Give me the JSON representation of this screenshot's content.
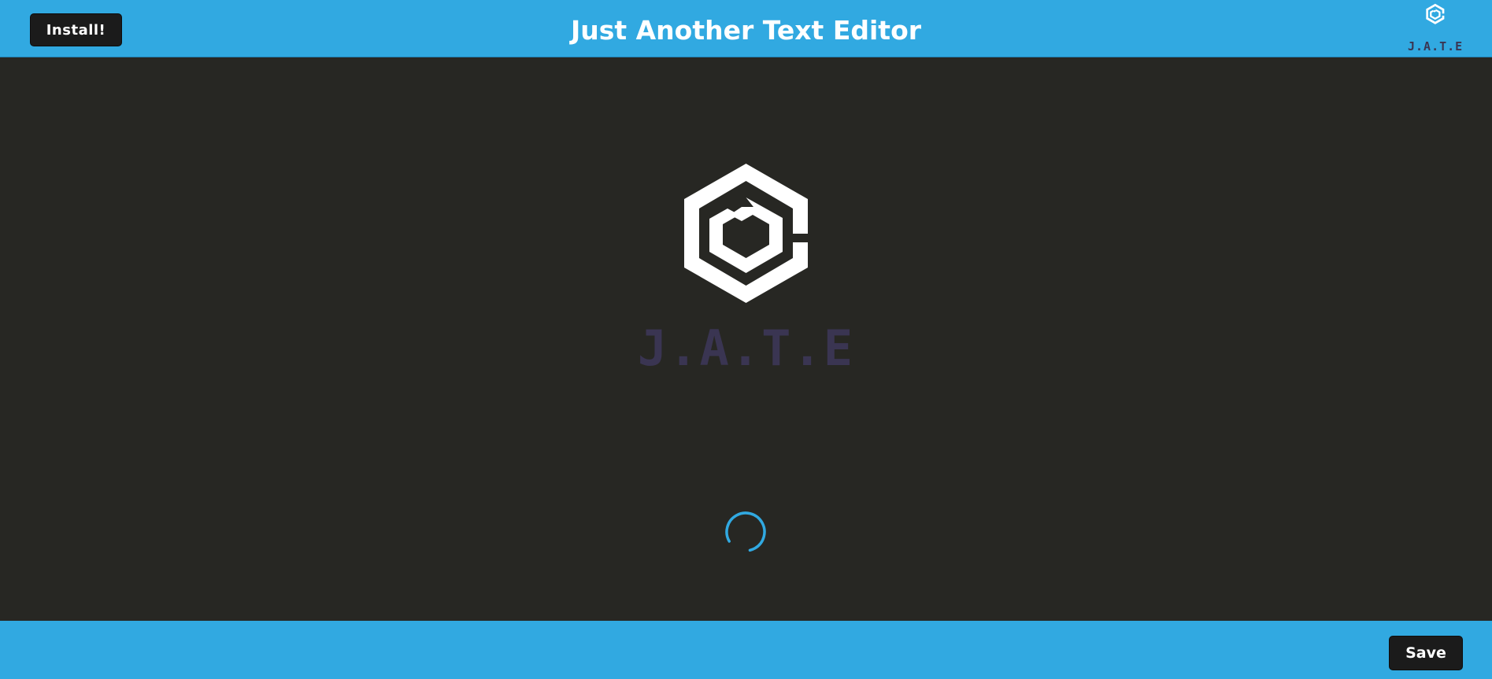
{
  "header": {
    "install_label": "Install!",
    "title": "Just Another Text Editor",
    "logo_text": "J.A.T.E",
    "logo_icon": "jate-cube-logo-icon"
  },
  "splash": {
    "logo_icon": "jate-cube-logo-icon",
    "wordmark": "J.A.T.E",
    "spinner_icon": "loading-spinner-icon"
  },
  "footer": {
    "save_label": "Save"
  },
  "colors": {
    "accent": "#31a9e1",
    "background": "#272723",
    "button": "#1b1b1b",
    "wordmark": "#3a3552",
    "logo": "#ffffff"
  }
}
